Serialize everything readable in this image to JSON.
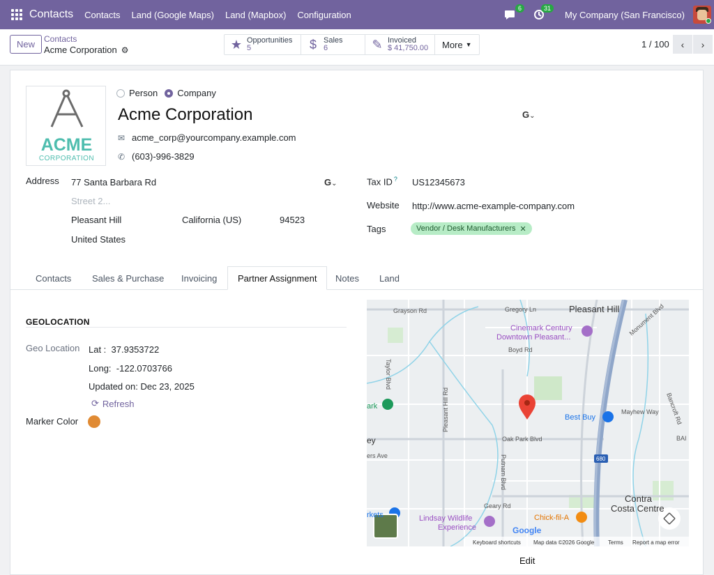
{
  "topnav": {
    "app_title": "Contacts",
    "menu": [
      "Contacts",
      "Land (Google Maps)",
      "Land (Mapbox)",
      "Configuration"
    ],
    "messages_count": "6",
    "activities_count": "31",
    "company": "My Company (San Francisco)"
  },
  "control": {
    "new_label": "New",
    "breadcrumb_parent": "Contacts",
    "breadcrumb_current": "Acme Corporation",
    "smart_buttons": [
      {
        "label": "Opportunities",
        "value": "5",
        "icon": "star-icon"
      },
      {
        "label": "Sales",
        "value": "6",
        "icon": "dollar-icon"
      },
      {
        "label": "Invoiced",
        "value": "$ 41,750.00",
        "icon": "edit-icon"
      }
    ],
    "more_label": "More",
    "pager": "1 / 100"
  },
  "partner": {
    "type_options": [
      "Person",
      "Company"
    ],
    "selected_type": "Company",
    "logo_text": "ACME",
    "logo_subtext": "CORPORATION",
    "name": "Acme Corporation",
    "email": "acme_corp@yourcompany.example.com",
    "phone": "(603)-996-3829",
    "address_label": "Address",
    "street": "77 Santa Barbara Rd",
    "street2_placeholder": "Street 2...",
    "city": "Pleasant Hill",
    "state": "California (US)",
    "zip": "94523",
    "country": "United States",
    "tax_id_label": "Tax ID",
    "tax_id_help": "?",
    "tax_id": "US12345673",
    "website_label": "Website",
    "website": "http://www.acme-example-company.com",
    "tags_label": "Tags",
    "tags": [
      "Vendor / Desk Manufacturers"
    ],
    "marker_color": "#e08a33"
  },
  "tabs": [
    "Contacts",
    "Sales & Purchase",
    "Invoicing",
    "Partner Assignment",
    "Notes",
    "Land"
  ],
  "active_tab": "Partner Assignment",
  "geolocation": {
    "section_title": "GEOLOCATION",
    "geo_label": "Geo Location",
    "lat_label": "Lat :",
    "lat": "37.9353722",
    "long_label": "Long:",
    "long": "-122.0703766",
    "updated_label": "Updated on:",
    "updated": "Dec 23, 2025",
    "refresh_label": "Refresh",
    "marker_color_label": "Marker Color"
  },
  "map": {
    "labels": {
      "pleasant_hill": "Pleasant Hill",
      "grayson": "Grayson Rd",
      "gregory": "Gregory Ln",
      "monument": "Monument Blvd",
      "cinemark1": "Cinemark Century",
      "cinemark2": "Downtown Pleasant...",
      "boyd": "Boyd Rd",
      "taylor": "Taylor Blvd",
      "pleasant_hill_rd": "Pleasant Hill Rd",
      "ark": "ark",
      "best_buy": "Best Buy",
      "mayhew": "Mayhew Way",
      "bancroft": "Bancroft Rd",
      "ey": "ey",
      "oak_park": "Oak Park Blvd",
      "bai": "BAI",
      "ers_ave": "ers Ave",
      "putnam": "Putnam Blvd",
      "i680": "680",
      "geary": "Geary Rd",
      "contra1": "Contra",
      "contra2": "Costa Centre",
      "rkets": "rkets",
      "lindsay1": "Lindsay Wildlife",
      "lindsay2": "Experience",
      "chickfila": "Chick-fil-A",
      "google": "Google",
      "kbd": "Keyboard shortcuts",
      "mapdata": "Map data ©2026 Google",
      "terms": "Terms",
      "report": "Report a map error"
    },
    "edit_label": "Edit"
  }
}
